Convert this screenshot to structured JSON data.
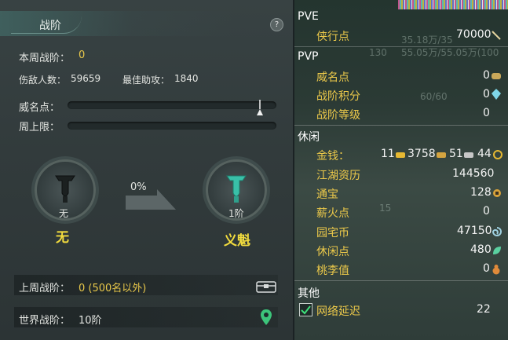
{
  "left": {
    "title": "战阶",
    "help": "?",
    "weekly_rank_label": "本周战阶：",
    "weekly_rank_value": "0",
    "kills_label": "伤敌人数：",
    "kills_value": "59659",
    "assist_label": "最佳助攻：",
    "assist_value": "1840",
    "prestige_label": "威名点：",
    "prestige_progress": 0.92,
    "weekly_cap_label": "周上限：",
    "weekly_cap_progress": 0,
    "current_rank_small": "无",
    "current_rank_name": "无",
    "progress_percent": "0%",
    "next_rank_small": "1阶",
    "next_rank_name": "义魁",
    "last_week_label": "上周战阶：",
    "last_week_value": "0 (500名以外)",
    "world_rank_label": "世界战阶：",
    "world_rank_value": "10阶"
  },
  "right": {
    "pve": {
      "heading": "PVE",
      "items": [
        {
          "label": "侠行点",
          "value": "70000",
          "icon": "sword-icon"
        }
      ]
    },
    "pvp": {
      "heading": "PVP",
      "items": [
        {
          "label": "威名点",
          "value": "0",
          "icon": "mask-icon"
        },
        {
          "label": "战阶积分",
          "value": "0",
          "icon": "crystal-icon"
        },
        {
          "label": "战阶等级",
          "value": "0"
        }
      ]
    },
    "leisure": {
      "heading": "休闲",
      "money_label": "金钱：",
      "money_gold": "11",
      "money_silver": "3758",
      "money_copper": "51",
      "money_bind": "44",
      "items": [
        {
          "label": "江湖资历",
          "value": "144560"
        },
        {
          "label": "通宝",
          "value": "128",
          "icon": "coin-icon"
        },
        {
          "label": "薪火点",
          "value": "0"
        },
        {
          "label": "园宅币",
          "value": "47150",
          "icon": "swirl-icon"
        },
        {
          "label": "休闲点",
          "value": "480",
          "icon": "leaf-icon"
        },
        {
          "label": "桃李值",
          "value": "0",
          "icon": "gourd-icon"
        }
      ]
    },
    "other": {
      "heading": "其他",
      "latency_label": "网络延迟",
      "latency_value": "22",
      "latency_checked": true
    },
    "background_text": {
      "hp": "35.18万/35",
      "mp": "55.05万/55.05万(100",
      "level": "130",
      "mid": "60/60",
      "num": "15"
    }
  }
}
